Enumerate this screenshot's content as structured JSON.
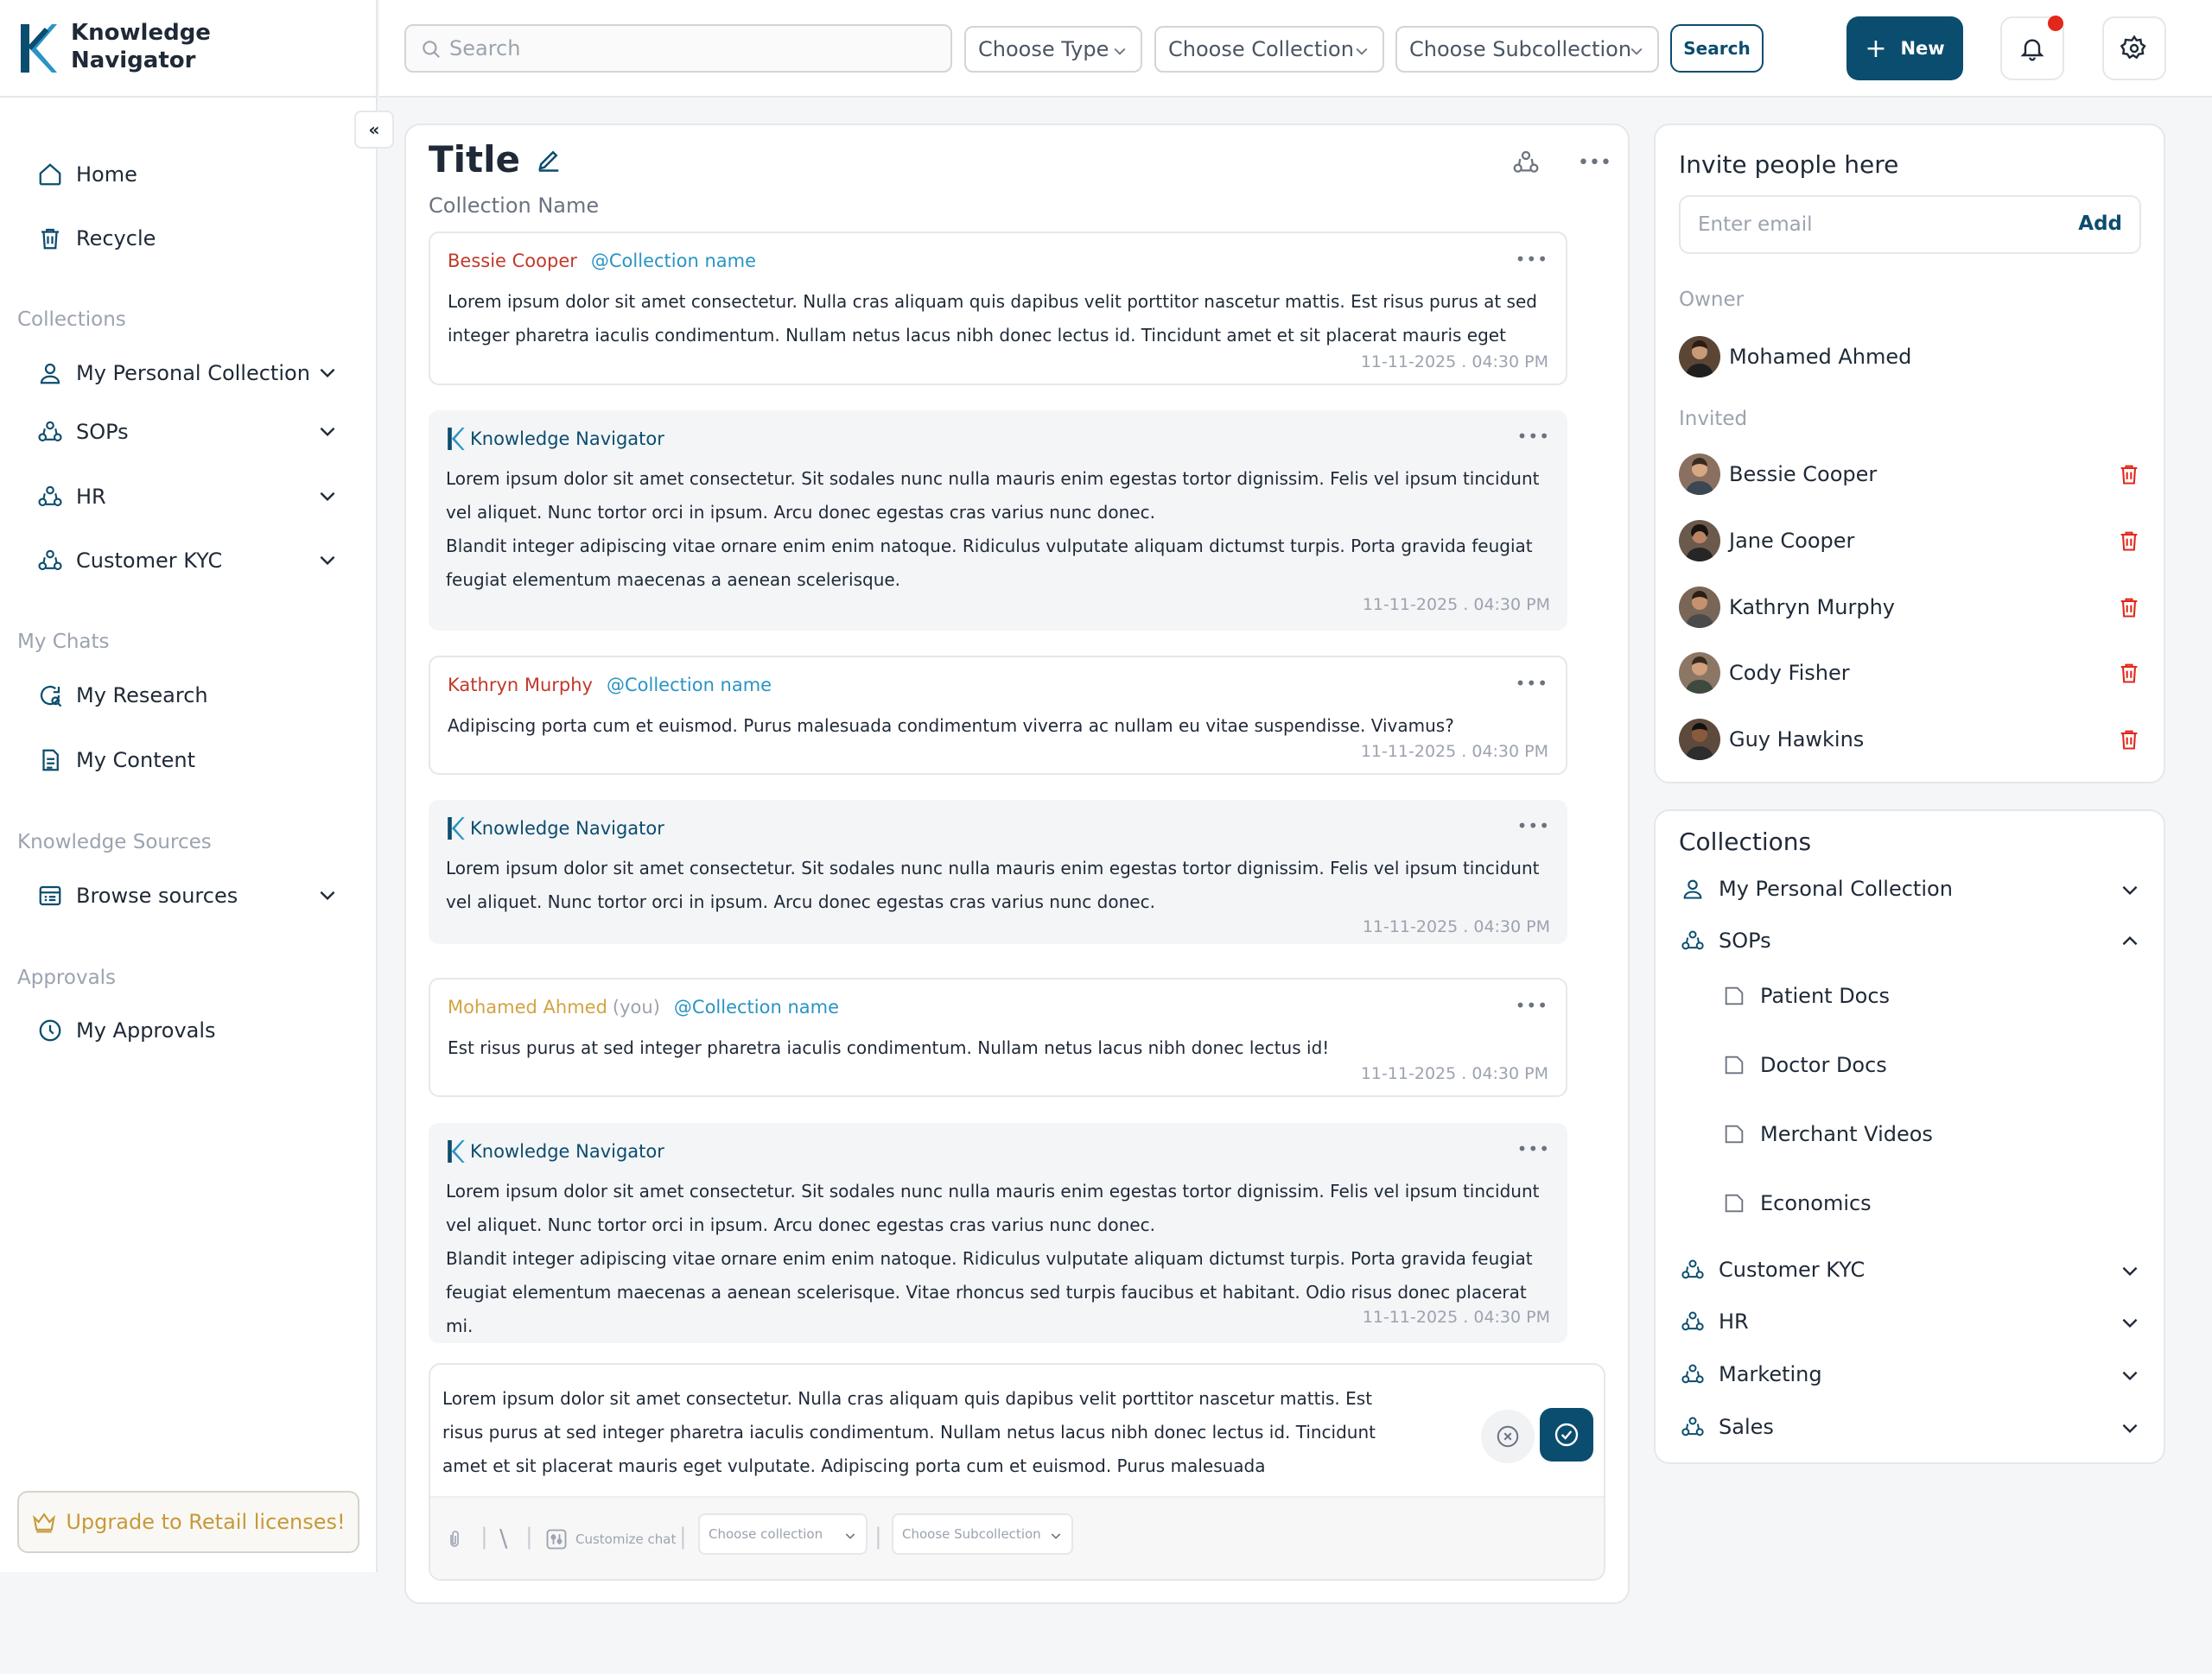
{
  "app": {
    "name_line1": "Knowledge",
    "name_line2": "Navigator"
  },
  "sidebar": {
    "items_top": [
      {
        "label": "Home",
        "icon": "home-icon"
      },
      {
        "label": "Recycle",
        "icon": "trash-icon"
      }
    ],
    "collections_label": "Collections",
    "collections": [
      {
        "label": "My Personal Collection",
        "icon": "user-icon"
      },
      {
        "label": "SOPs",
        "icon": "group-icon"
      },
      {
        "label": "HR",
        "icon": "group-icon"
      },
      {
        "label": "Customer KYC",
        "icon": "group-icon"
      }
    ],
    "chats_label": "My Chats",
    "chats": [
      {
        "label": "My Research",
        "icon": "research-icon"
      },
      {
        "label": "My Content",
        "icon": "document-icon"
      }
    ],
    "sources_label": "Knowledge Sources",
    "sources": [
      {
        "label": "Browse sources",
        "icon": "browse-icon"
      }
    ],
    "approvals_label": "Approvals",
    "approvals": [
      {
        "label": "My Approvals",
        "icon": "clock-icon"
      }
    ],
    "upgrade_label": "Upgrade to Retail licenses!"
  },
  "topbar": {
    "search_placeholder": "Search",
    "type_dropdown": "Choose Type",
    "collection_dropdown": "Choose Collection",
    "subcollection_dropdown": "Choose Subcollection",
    "search_button": "Search",
    "new_button": "New"
  },
  "chat": {
    "title": "Title",
    "subtitle": "Collection Name",
    "messages": [
      {
        "kind": "user",
        "author": "Bessie Cooper",
        "mention": "@Collection name",
        "body": "Lorem ipsum dolor sit amet consectetur. Nulla cras aliquam quis dapibus velit porttitor nascetur mattis. Est risus purus at sed integer pharetra iaculis condimentum. Nullam netus lacus nibh donec lectus id. Tincidunt amet et sit placerat mauris eget vulputate. Adipisc...",
        "time": "11-11-2025 . 04:30 PM"
      },
      {
        "kind": "bot",
        "author": "Knowledge Navigator",
        "body": "Lorem ipsum dolor sit amet consectetur. Sit sodales nunc nulla mauris enim egestas tortor dignissim. Felis vel ipsum tincidunt vel aliquet. Nunc tortor orci in ipsum. Arcu donec egestas cras varius nunc donec.",
        "body2": "Blandit integer adipiscing vitae ornare enim enim natoque. Ridiculus vulputate aliquam dictumst turpis. Porta gravida feugiat feugiat elementum maecenas a aenean scelerisque.",
        "time": "11-11-2025 . 04:30 PM"
      },
      {
        "kind": "user",
        "author": "Kathryn Murphy",
        "mention": "@Collection name",
        "body": "Adipiscing porta cum et euismod. Purus malesuada condimentum viverra ac nullam eu vitae suspendisse. Vivamus?",
        "time": "11-11-2025 . 04:30 PM"
      },
      {
        "kind": "bot",
        "author": "Knowledge Navigator",
        "body": "Lorem ipsum dolor sit amet consectetur. Sit sodales nunc nulla mauris enim egestas tortor dignissim. Felis vel ipsum tincidunt vel aliquet. Nunc tortor orci in ipsum. Arcu donec egestas cras varius nunc donec.",
        "time": "11-11-2025 . 04:30 PM"
      },
      {
        "kind": "me",
        "author": "Mohamed Ahmed",
        "you": "(you)",
        "mention": "@Collection name",
        "body": "Est risus purus at sed integer pharetra iaculis condimentum. Nullam netus lacus nibh donec lectus id!",
        "time": "11-11-2025 . 04:30 PM"
      },
      {
        "kind": "bot",
        "author": "Knowledge Navigator",
        "body": "Lorem ipsum dolor sit amet consectetur. Sit sodales nunc nulla mauris enim egestas tortor dignissim. Felis vel ipsum tincidunt vel aliquet. Nunc tortor orci in ipsum. Arcu donec egestas cras varius nunc donec.",
        "body2": "Blandit integer adipiscing vitae ornare enim enim natoque. Ridiculus vulputate aliquam dictumst turpis. Porta gravida feugiat feugiat elementum maecenas a aenean scelerisque. Vitae rhoncus sed turpis faucibus et habitant. Odio risus donec placerat mi.",
        "time": "11-11-2025 . 04:30 PM"
      }
    ],
    "composer": {
      "text": "Lorem ipsum dolor sit amet consectetur. Nulla cras aliquam quis dapibus velit porttitor nascetur mattis. Est risus purus at sed integer pharetra iaculis condimentum. Nullam netus lacus nibh donec lectus id. Tincidunt amet et sit placerat mauris eget vulputate. Adipiscing porta cum et euismod. Purus malesuada condimentum viverra ac nulla...",
      "customize_label": "Customize chat",
      "collection_dd": "Choose collection",
      "subcollection_dd": "Choose Subcollection"
    }
  },
  "invite": {
    "title": "Invite people here",
    "email_placeholder": "Enter email",
    "add_label": "Add",
    "owner_label": "Owner",
    "owner": "Mohamed Ahmed",
    "invited_label": "Invited",
    "invited": [
      "Bessie Cooper",
      "Jane Cooper",
      "Kathryn Murphy",
      "Cody Fisher",
      "Guy Hawkins"
    ]
  },
  "collections_panel": {
    "title": "Collections",
    "items": [
      {
        "label": "My Personal Collection",
        "icon": "user-icon"
      },
      {
        "label": "SOPs",
        "icon": "group-icon",
        "expanded": true,
        "children": [
          "Patient Docs",
          "Doctor Docs",
          "Merchant Videos",
          "Economics"
        ]
      },
      {
        "label": "Customer KYC",
        "icon": "group-icon"
      },
      {
        "label": "HR",
        "icon": "group-icon"
      },
      {
        "label": "Marketing",
        "icon": "group-icon"
      },
      {
        "label": "Sales",
        "icon": "group-icon"
      }
    ]
  },
  "colors": {
    "brand": "#0b4d6e",
    "accent": "#2a94c4",
    "danger": "#e3271b",
    "user_author": "#c0392b",
    "me_author": "#d4a341"
  }
}
